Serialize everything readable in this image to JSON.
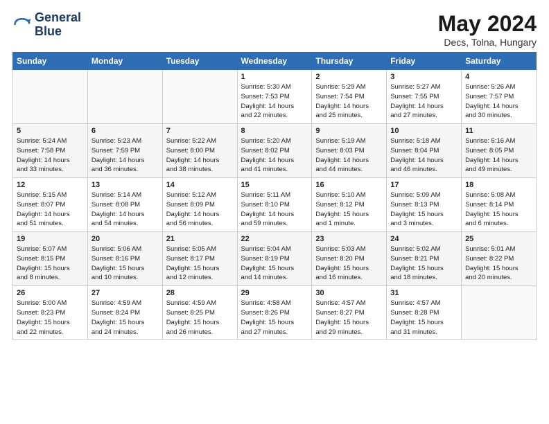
{
  "logo": {
    "line1": "General",
    "line2": "Blue"
  },
  "title": "May 2024",
  "location": "Decs, Tolna, Hungary",
  "weekdays": [
    "Sunday",
    "Monday",
    "Tuesday",
    "Wednesday",
    "Thursday",
    "Friday",
    "Saturday"
  ],
  "weeks": [
    [
      {
        "day": "",
        "info": ""
      },
      {
        "day": "",
        "info": ""
      },
      {
        "day": "",
        "info": ""
      },
      {
        "day": "1",
        "info": "Sunrise: 5:30 AM\nSunset: 7:53 PM\nDaylight: 14 hours\nand 22 minutes."
      },
      {
        "day": "2",
        "info": "Sunrise: 5:29 AM\nSunset: 7:54 PM\nDaylight: 14 hours\nand 25 minutes."
      },
      {
        "day": "3",
        "info": "Sunrise: 5:27 AM\nSunset: 7:55 PM\nDaylight: 14 hours\nand 27 minutes."
      },
      {
        "day": "4",
        "info": "Sunrise: 5:26 AM\nSunset: 7:57 PM\nDaylight: 14 hours\nand 30 minutes."
      }
    ],
    [
      {
        "day": "5",
        "info": "Sunrise: 5:24 AM\nSunset: 7:58 PM\nDaylight: 14 hours\nand 33 minutes."
      },
      {
        "day": "6",
        "info": "Sunrise: 5:23 AM\nSunset: 7:59 PM\nDaylight: 14 hours\nand 36 minutes."
      },
      {
        "day": "7",
        "info": "Sunrise: 5:22 AM\nSunset: 8:00 PM\nDaylight: 14 hours\nand 38 minutes."
      },
      {
        "day": "8",
        "info": "Sunrise: 5:20 AM\nSunset: 8:02 PM\nDaylight: 14 hours\nand 41 minutes."
      },
      {
        "day": "9",
        "info": "Sunrise: 5:19 AM\nSunset: 8:03 PM\nDaylight: 14 hours\nand 44 minutes."
      },
      {
        "day": "10",
        "info": "Sunrise: 5:18 AM\nSunset: 8:04 PM\nDaylight: 14 hours\nand 46 minutes."
      },
      {
        "day": "11",
        "info": "Sunrise: 5:16 AM\nSunset: 8:05 PM\nDaylight: 14 hours\nand 49 minutes."
      }
    ],
    [
      {
        "day": "12",
        "info": "Sunrise: 5:15 AM\nSunset: 8:07 PM\nDaylight: 14 hours\nand 51 minutes."
      },
      {
        "day": "13",
        "info": "Sunrise: 5:14 AM\nSunset: 8:08 PM\nDaylight: 14 hours\nand 54 minutes."
      },
      {
        "day": "14",
        "info": "Sunrise: 5:12 AM\nSunset: 8:09 PM\nDaylight: 14 hours\nand 56 minutes."
      },
      {
        "day": "15",
        "info": "Sunrise: 5:11 AM\nSunset: 8:10 PM\nDaylight: 14 hours\nand 59 minutes."
      },
      {
        "day": "16",
        "info": "Sunrise: 5:10 AM\nSunset: 8:12 PM\nDaylight: 15 hours\nand 1 minute."
      },
      {
        "day": "17",
        "info": "Sunrise: 5:09 AM\nSunset: 8:13 PM\nDaylight: 15 hours\nand 3 minutes."
      },
      {
        "day": "18",
        "info": "Sunrise: 5:08 AM\nSunset: 8:14 PM\nDaylight: 15 hours\nand 6 minutes."
      }
    ],
    [
      {
        "day": "19",
        "info": "Sunrise: 5:07 AM\nSunset: 8:15 PM\nDaylight: 15 hours\nand 8 minutes."
      },
      {
        "day": "20",
        "info": "Sunrise: 5:06 AM\nSunset: 8:16 PM\nDaylight: 15 hours\nand 10 minutes."
      },
      {
        "day": "21",
        "info": "Sunrise: 5:05 AM\nSunset: 8:17 PM\nDaylight: 15 hours\nand 12 minutes."
      },
      {
        "day": "22",
        "info": "Sunrise: 5:04 AM\nSunset: 8:19 PM\nDaylight: 15 hours\nand 14 minutes."
      },
      {
        "day": "23",
        "info": "Sunrise: 5:03 AM\nSunset: 8:20 PM\nDaylight: 15 hours\nand 16 minutes."
      },
      {
        "day": "24",
        "info": "Sunrise: 5:02 AM\nSunset: 8:21 PM\nDaylight: 15 hours\nand 18 minutes."
      },
      {
        "day": "25",
        "info": "Sunrise: 5:01 AM\nSunset: 8:22 PM\nDaylight: 15 hours\nand 20 minutes."
      }
    ],
    [
      {
        "day": "26",
        "info": "Sunrise: 5:00 AM\nSunset: 8:23 PM\nDaylight: 15 hours\nand 22 minutes."
      },
      {
        "day": "27",
        "info": "Sunrise: 4:59 AM\nSunset: 8:24 PM\nDaylight: 15 hours\nand 24 minutes."
      },
      {
        "day": "28",
        "info": "Sunrise: 4:59 AM\nSunset: 8:25 PM\nDaylight: 15 hours\nand 26 minutes."
      },
      {
        "day": "29",
        "info": "Sunrise: 4:58 AM\nSunset: 8:26 PM\nDaylight: 15 hours\nand 27 minutes."
      },
      {
        "day": "30",
        "info": "Sunrise: 4:57 AM\nSunset: 8:27 PM\nDaylight: 15 hours\nand 29 minutes."
      },
      {
        "day": "31",
        "info": "Sunrise: 4:57 AM\nSunset: 8:28 PM\nDaylight: 15 hours\nand 31 minutes."
      },
      {
        "day": "",
        "info": ""
      }
    ]
  ]
}
